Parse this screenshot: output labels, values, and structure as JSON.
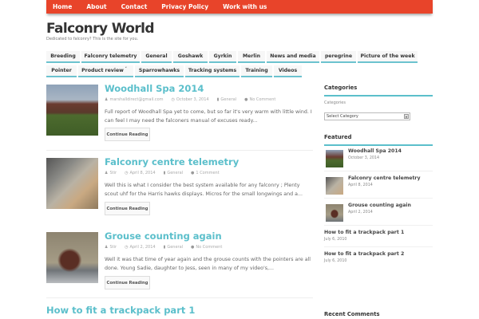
{
  "top_menu": [
    "Home",
    "About",
    "Contact",
    "Privacy Policy",
    "Work with us"
  ],
  "site": {
    "title": "Falconry World",
    "tagline": "Dedicated to falconry? This is the site for you."
  },
  "nav_row1": [
    "Breeding",
    "Falconry telemetry",
    "General",
    "Goshawk",
    "Gyrkin",
    "Merlin",
    "News and media",
    "peregrine",
    "Picture of the week"
  ],
  "nav_row2": [
    "Pointer",
    "Product review",
    "Sparrowhawks",
    "Tracking systems",
    "Training",
    "Videos"
  ],
  "nav_caret": "˅",
  "posts": [
    {
      "title": "Woodhall Spa 2014",
      "author": "marshalldirect@gmail.com",
      "date": "October 3, 2014",
      "category": "General",
      "comments": "No Comment",
      "excerpt": "Full report of Woodhall Spa yet to come, but so far it's very warm with little wind.  I can feel I may need the falconers manual of excuses ready...",
      "button": "Continue Reading"
    },
    {
      "title": "Falconry centre telemetry",
      "author": "Stir",
      "date": "April 8, 2014",
      "category": "General",
      "comments": "1 Comment",
      "excerpt": "Well this is what I consider the best system available for any falconry ; Plenty scout uhf for the Harris hawks displays. Micros for the small longwings and a...",
      "button": "Continue Reading"
    },
    {
      "title": "Grouse counting again",
      "author": "Stir",
      "date": "April 2, 2014",
      "category": "General",
      "comments": "No Comment",
      "excerpt": "Well it was that time of year again and the grouse counts with the pointers are all done. Young Sadie, daughter to Jess, seen in many of my video's,...",
      "button": "Continue Reading"
    },
    {
      "title": "How to fit a trackpack part 1"
    }
  ],
  "sidebar": {
    "categories_heading": "Categories",
    "categories_label": "Categories",
    "select_value": "Select Category",
    "featured_heading": "Featured",
    "featured": [
      {
        "title": "Woodhall Spa 2014",
        "date": "October 3, 2014"
      },
      {
        "title": "Falconry centre telemetry",
        "date": "April 8, 2014"
      },
      {
        "title": "Grouse counting again",
        "date": "April 2, 2014"
      },
      {
        "title": "How to fit a trackpack part 1",
        "date": "July 6, 2010"
      },
      {
        "title": "How to fit a trackpack part 2",
        "date": "July 6, 2010"
      }
    ],
    "recent_comments_heading": "Recent Comments"
  },
  "colors": {
    "accent": "#5bbfcb",
    "topbar": "#e8442a"
  }
}
